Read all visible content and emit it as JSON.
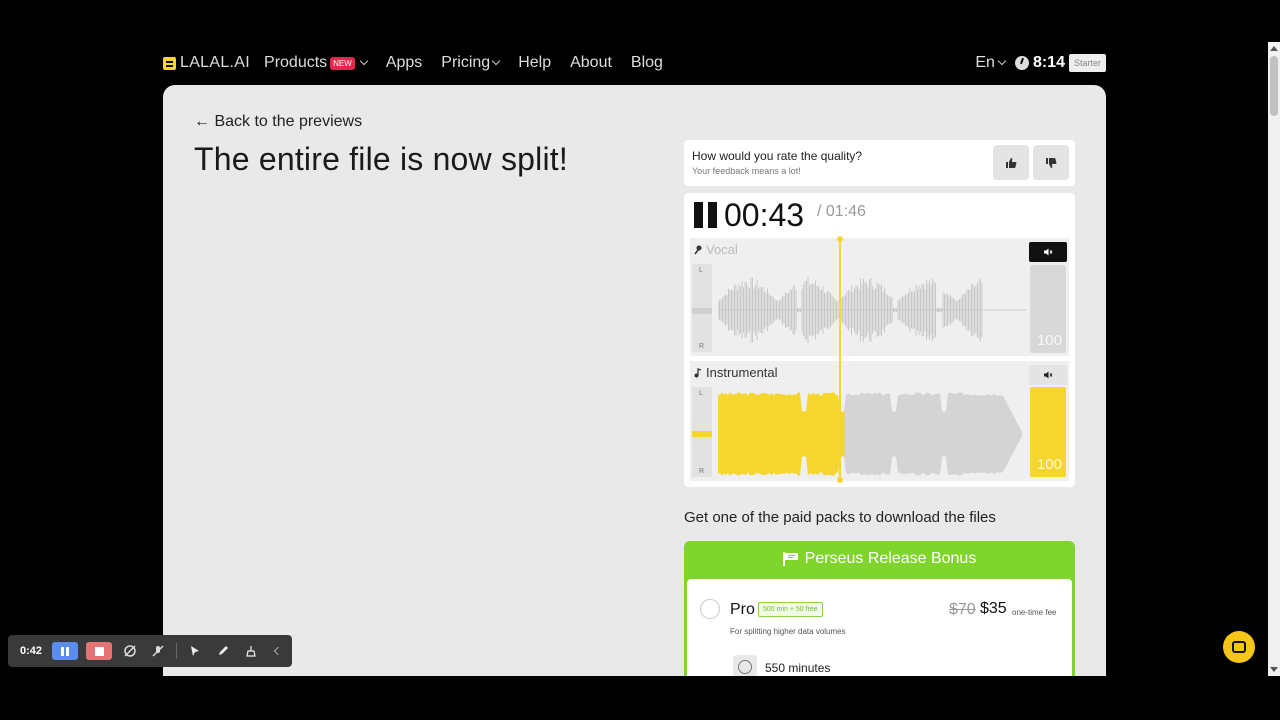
{
  "nav": {
    "logo": "LALAL.AI",
    "products": "Products",
    "new_badge": "NEW",
    "apps": "Apps",
    "pricing": "Pricing",
    "help": "Help",
    "about": "About",
    "blog": "Blog",
    "lang": "En",
    "time_left": "8:14",
    "plan": "Starter"
  },
  "main": {
    "back": "← Back to the previews",
    "title": "The entire file is now split!"
  },
  "feedback": {
    "question": "How would you rate the quality?",
    "sub": "Your feedback means a lot!"
  },
  "player": {
    "current_time": "00:43",
    "total_time": "/ 01:46",
    "tracks": [
      {
        "name": "Vocal",
        "l": "L",
        "r": "R",
        "volume": "100",
        "muted": true
      },
      {
        "name": "Instrumental",
        "l": "L",
        "r": "R",
        "volume": "100",
        "muted": false
      }
    ],
    "progress": 0.41
  },
  "packs": {
    "title": "Get one of the paid packs to download the files",
    "bonus_title": "Perseus Release Bonus",
    "plan": {
      "name": "Pro",
      "tag": "500 min + 50 free",
      "desc": "For splitting higher data volumes",
      "old_price": "$70",
      "price": "$35",
      "fee": "one-time fee",
      "minutes": "550 minutes"
    }
  },
  "recorder": {
    "time": "0:42"
  },
  "colors": {
    "accent": "#f5d62f",
    "green": "#7fd52b",
    "new_badge": "#e8264d"
  }
}
